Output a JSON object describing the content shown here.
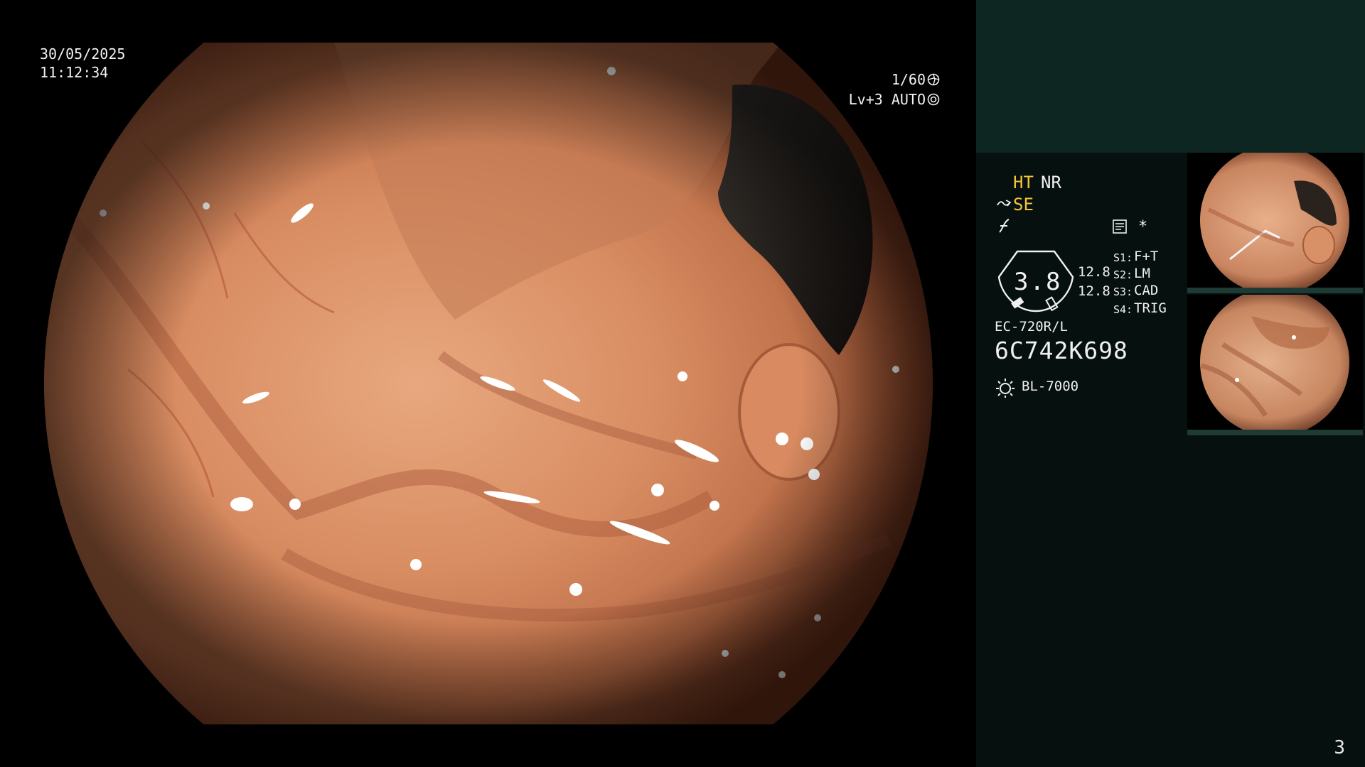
{
  "overlay": {
    "date": "30/05/2025",
    "time": "11:12:34",
    "shutter": "1/60",
    "level": "Lv+3 AUTO"
  },
  "panel": {
    "ht": "HT",
    "nr": "NR",
    "se": "SE",
    "star": "*",
    "gauge_value": "3.8",
    "value_a": "12.8",
    "value_b": "12.8",
    "switches": [
      {
        "label": "S1:",
        "value": "F+T"
      },
      {
        "label": "S2:",
        "value": "LM"
      },
      {
        "label": "S3:",
        "value": "CAD"
      },
      {
        "label": "S4:",
        "value": "TRIG"
      }
    ],
    "scope_model": "EC-720R/L",
    "serial": "6C742K698",
    "light_source": "BL-7000",
    "page_number": "3"
  },
  "colors": {
    "panel_bg": "#06100e",
    "panel_band": "#0d2622",
    "accent_yellow": "#f5c23a",
    "text": "#f0f0f0"
  },
  "icons": [
    "shutter-icon",
    "auto-iris-icon",
    "structure-enhancement-icon",
    "freeze-icon",
    "document-icon",
    "gauge-icon",
    "light-source-icon"
  ]
}
